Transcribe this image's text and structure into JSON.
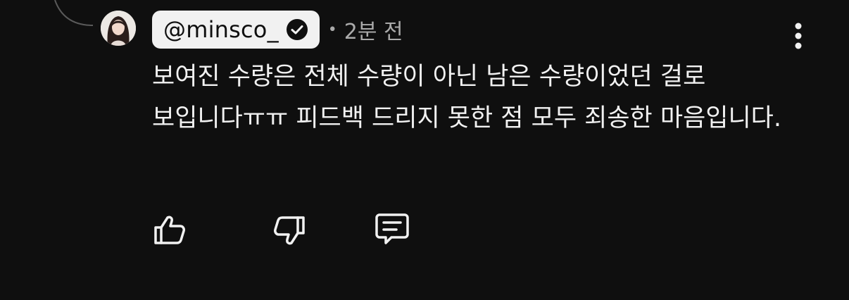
{
  "comment": {
    "author": "@minsco_",
    "timestamp": "2분 전",
    "separator": "•",
    "text": "보여진 수량은 전체 수량이 아닌 남은 수량이었던 걸로 보입니다ㅠㅠ 피드백 드리지 못한 점 모두 죄송한 마음입니다."
  },
  "icons": {
    "verified": "verified-check-icon",
    "menu": "more-vertical-icon",
    "like": "thumbs-up-icon",
    "dislike": "thumbs-down-icon",
    "reply": "reply-comment-icon"
  },
  "colors": {
    "background": "#0f0f0f",
    "text": "#f1f1f1",
    "secondary_text": "#aaaaaa",
    "author_chip": "#f1f1f1"
  }
}
